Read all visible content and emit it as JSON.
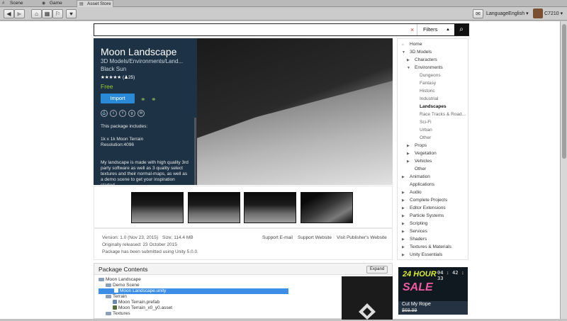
{
  "tabs": [
    {
      "label": "Scene",
      "icon": "scene-icon"
    },
    {
      "label": "Game",
      "icon": "game-icon"
    },
    {
      "label": "Asset Store",
      "icon": "asset-store-icon"
    }
  ],
  "toolbar": {
    "language_label": "Language",
    "language_value": "English",
    "account": "C7210",
    "icons": [
      "back-icon",
      "forward-icon",
      "home-icon",
      "category-icon",
      "cart-icon",
      "wishlist-icon",
      "notification-icon"
    ]
  },
  "search": {
    "value": "",
    "clear": "×",
    "filters_label": "Filters",
    "filters_arrow": "▲",
    "button_icon": "⌕"
  },
  "product": {
    "title": "Moon Landscape",
    "category": "3D Models/Environments/Land...",
    "publisher": "Black Sun",
    "stars": "★★★★★",
    "rating_count": "(♟25)",
    "price": "Free",
    "import_label": "Import",
    "includes_heading": "This package includes:",
    "includes_line1": "1k x 1k Moon Terrain",
    "includes_line2": "Resolution:4096",
    "description": "My landscape is made with high quality 3rd party software as well as 3 quality select textures and their normal-maps, as well as a demo scene to get your inspiration started."
  },
  "meta": {
    "version": "Version: 1.0 (Nov 23, 2015)",
    "size": "Size: 114.4 MB",
    "released": "Originally released: 23 October 2015",
    "submitted": "Package has been submitted using Unity 5.0.0.",
    "support_email": "Support E-mail",
    "support_website": "Support Website",
    "publisher_website": "Visit Publisher's Website"
  },
  "sidebar": {
    "home": "Home",
    "models": "3D Models",
    "characters": "Characters",
    "environments": "Environments",
    "env_items": [
      "Dungeons",
      "Fantasy",
      "Historic",
      "Industrial",
      "Landscapes",
      "Race Tracks & Road...",
      "Sci-Fi",
      "Urban",
      "Other"
    ],
    "props": "Props",
    "vegetation": "Vegetation",
    "vehicles": "Vehicles",
    "other": "Other",
    "top_items": [
      "Animation",
      "Applications",
      "Audio",
      "Complete Projects",
      "Editor Extensions",
      "Particle Systems",
      "Scripting",
      "Services",
      "Shaders",
      "Textures & Materials",
      "Unity Essentials"
    ]
  },
  "package": {
    "heading": "Package Contents",
    "expand": "Expand",
    "tree": [
      {
        "label": "Moon Landscape"
      },
      {
        "label": "Demo Scene"
      },
      {
        "label": "Moon Landscape.unity"
      },
      {
        "label": "Terrain"
      },
      {
        "label": "Moon Terrain.prefab"
      },
      {
        "label": "Moon Terrain_x0_y0.asset"
      },
      {
        "label": "Textures"
      }
    ]
  },
  "ad": {
    "line1": "24 HOUR",
    "line2": "SALE",
    "timer": "04 : 42 : 33",
    "name": "Cut My Rope",
    "price": "$69.99"
  }
}
